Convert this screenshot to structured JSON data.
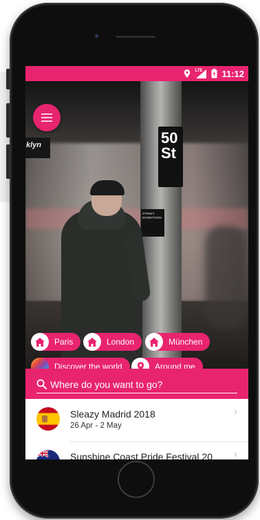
{
  "status_bar": {
    "network": "LTE",
    "time": "11:12",
    "icons": [
      "location-icon",
      "signal-icon",
      "battery-icon"
    ]
  },
  "hero": {
    "photo_sign_text": "50\nSt",
    "photo_sign_street": "STREET\nDOWNTOWN",
    "photo_side_text": "klyn"
  },
  "quick_links": {
    "cities": [
      {
        "label": "Paris",
        "icon": "home-icon"
      },
      {
        "label": "London",
        "icon": "home-icon"
      },
      {
        "label": "München",
        "icon": "home-icon"
      }
    ],
    "discover": {
      "label": "Discover the world",
      "icon": "globe-icon"
    },
    "around": {
      "label": "Around me",
      "icon": "location-pin-icon"
    }
  },
  "search": {
    "placeholder": "Where do you want to go?",
    "icon": "search-icon"
  },
  "events": [
    {
      "title": "Sleazy Madrid 2018",
      "dates": "26 Apr - 2 May",
      "flag": "spain-flag-icon"
    },
    {
      "title": "Sunshine Coast Pride Festival 20",
      "dates": "",
      "flag": "australia-flag-icon"
    }
  ],
  "colors": {
    "accent": "#e8246f",
    "text_dark": "#222222",
    "divider": "#e4e4e4"
  }
}
